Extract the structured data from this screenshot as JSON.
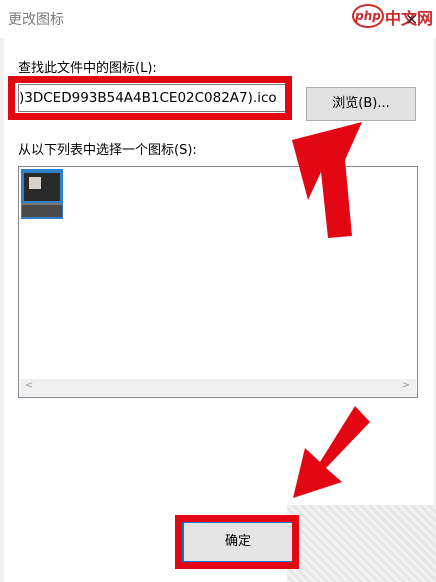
{
  "window": {
    "title": "更改图标",
    "close_glyph": "✕"
  },
  "watermark": {
    "badge": "php",
    "text": "中文网"
  },
  "file_section": {
    "label": "查找此文件中的图标(L):",
    "value": ")3DCED993B54A4B1CE02C082A7).ico",
    "browse_label": "浏览(B)..."
  },
  "icon_section": {
    "label": "从以下列表中选择一个图标(S):",
    "items": [
      {
        "icon": "computer-icon"
      }
    ]
  },
  "footer": {
    "ok_label": "确定"
  },
  "colors": {
    "annotation_red": "#e30613",
    "focus_blue": "#0078d7",
    "tile_blue": "#2f7fc9"
  }
}
